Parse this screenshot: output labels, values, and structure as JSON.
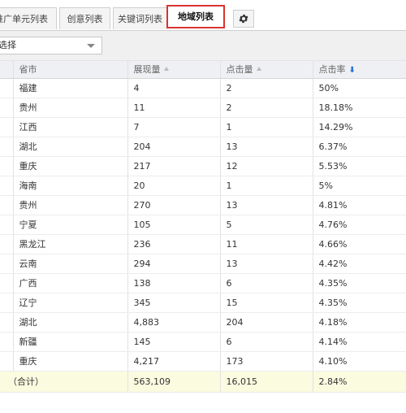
{
  "tabs": [
    {
      "label": "推广单元列表"
    },
    {
      "label": "创意列表"
    },
    {
      "label": "关键词列表"
    },
    {
      "label": "地域列表"
    }
  ],
  "filter": {
    "select_value": "请选择"
  },
  "table": {
    "headers": [
      "省市",
      "展现量",
      "点击量",
      "点击率"
    ],
    "rows": [
      {
        "region": "福建",
        "impressions": "4",
        "clicks": "2",
        "ctr": "50%"
      },
      {
        "region": "贵州",
        "impressions": "11",
        "clicks": "2",
        "ctr": "18.18%"
      },
      {
        "region": "江西",
        "impressions": "7",
        "clicks": "1",
        "ctr": "14.29%"
      },
      {
        "region": "湖北",
        "impressions": "204",
        "clicks": "13",
        "ctr": "6.37%"
      },
      {
        "region": "重庆",
        "impressions": "217",
        "clicks": "12",
        "ctr": "5.53%"
      },
      {
        "region": "海南",
        "impressions": "20",
        "clicks": "1",
        "ctr": "5%"
      },
      {
        "region": "贵州",
        "impressions": "270",
        "clicks": "13",
        "ctr": "4.81%"
      },
      {
        "region": "宁夏",
        "impressions": "105",
        "clicks": "5",
        "ctr": "4.76%"
      },
      {
        "region": "黑龙江",
        "impressions": "236",
        "clicks": "11",
        "ctr": "4.66%"
      },
      {
        "region": "云南",
        "impressions": "294",
        "clicks": "13",
        "ctr": "4.42%"
      },
      {
        "region": "广西",
        "impressions": "138",
        "clicks": "6",
        "ctr": "4.35%"
      },
      {
        "region": "辽宁",
        "impressions": "345",
        "clicks": "15",
        "ctr": "4.35%"
      },
      {
        "region": "湖北",
        "impressions": "4,883",
        "clicks": "204",
        "ctr": "4.18%"
      },
      {
        "region": "新疆",
        "impressions": "145",
        "clicks": "6",
        "ctr": "4.14%"
      },
      {
        "region": "重庆",
        "impressions": "4,217",
        "clicks": "173",
        "ctr": "4.10%"
      }
    ],
    "total": {
      "label": "（合计）",
      "impressions": "563,109",
      "clicks": "16,015",
      "ctr": "2.84%"
    }
  },
  "icons": {
    "settings": "gear-icon",
    "sort_up": "sort-up-icon",
    "sort_down": "sort-down-icon",
    "dropdown": "chevron-down-icon"
  },
  "colors": {
    "active_tab_border": "#d9332f",
    "sort_active": "#2a6fd6",
    "total_row_bg": "#fbfbe0"
  }
}
